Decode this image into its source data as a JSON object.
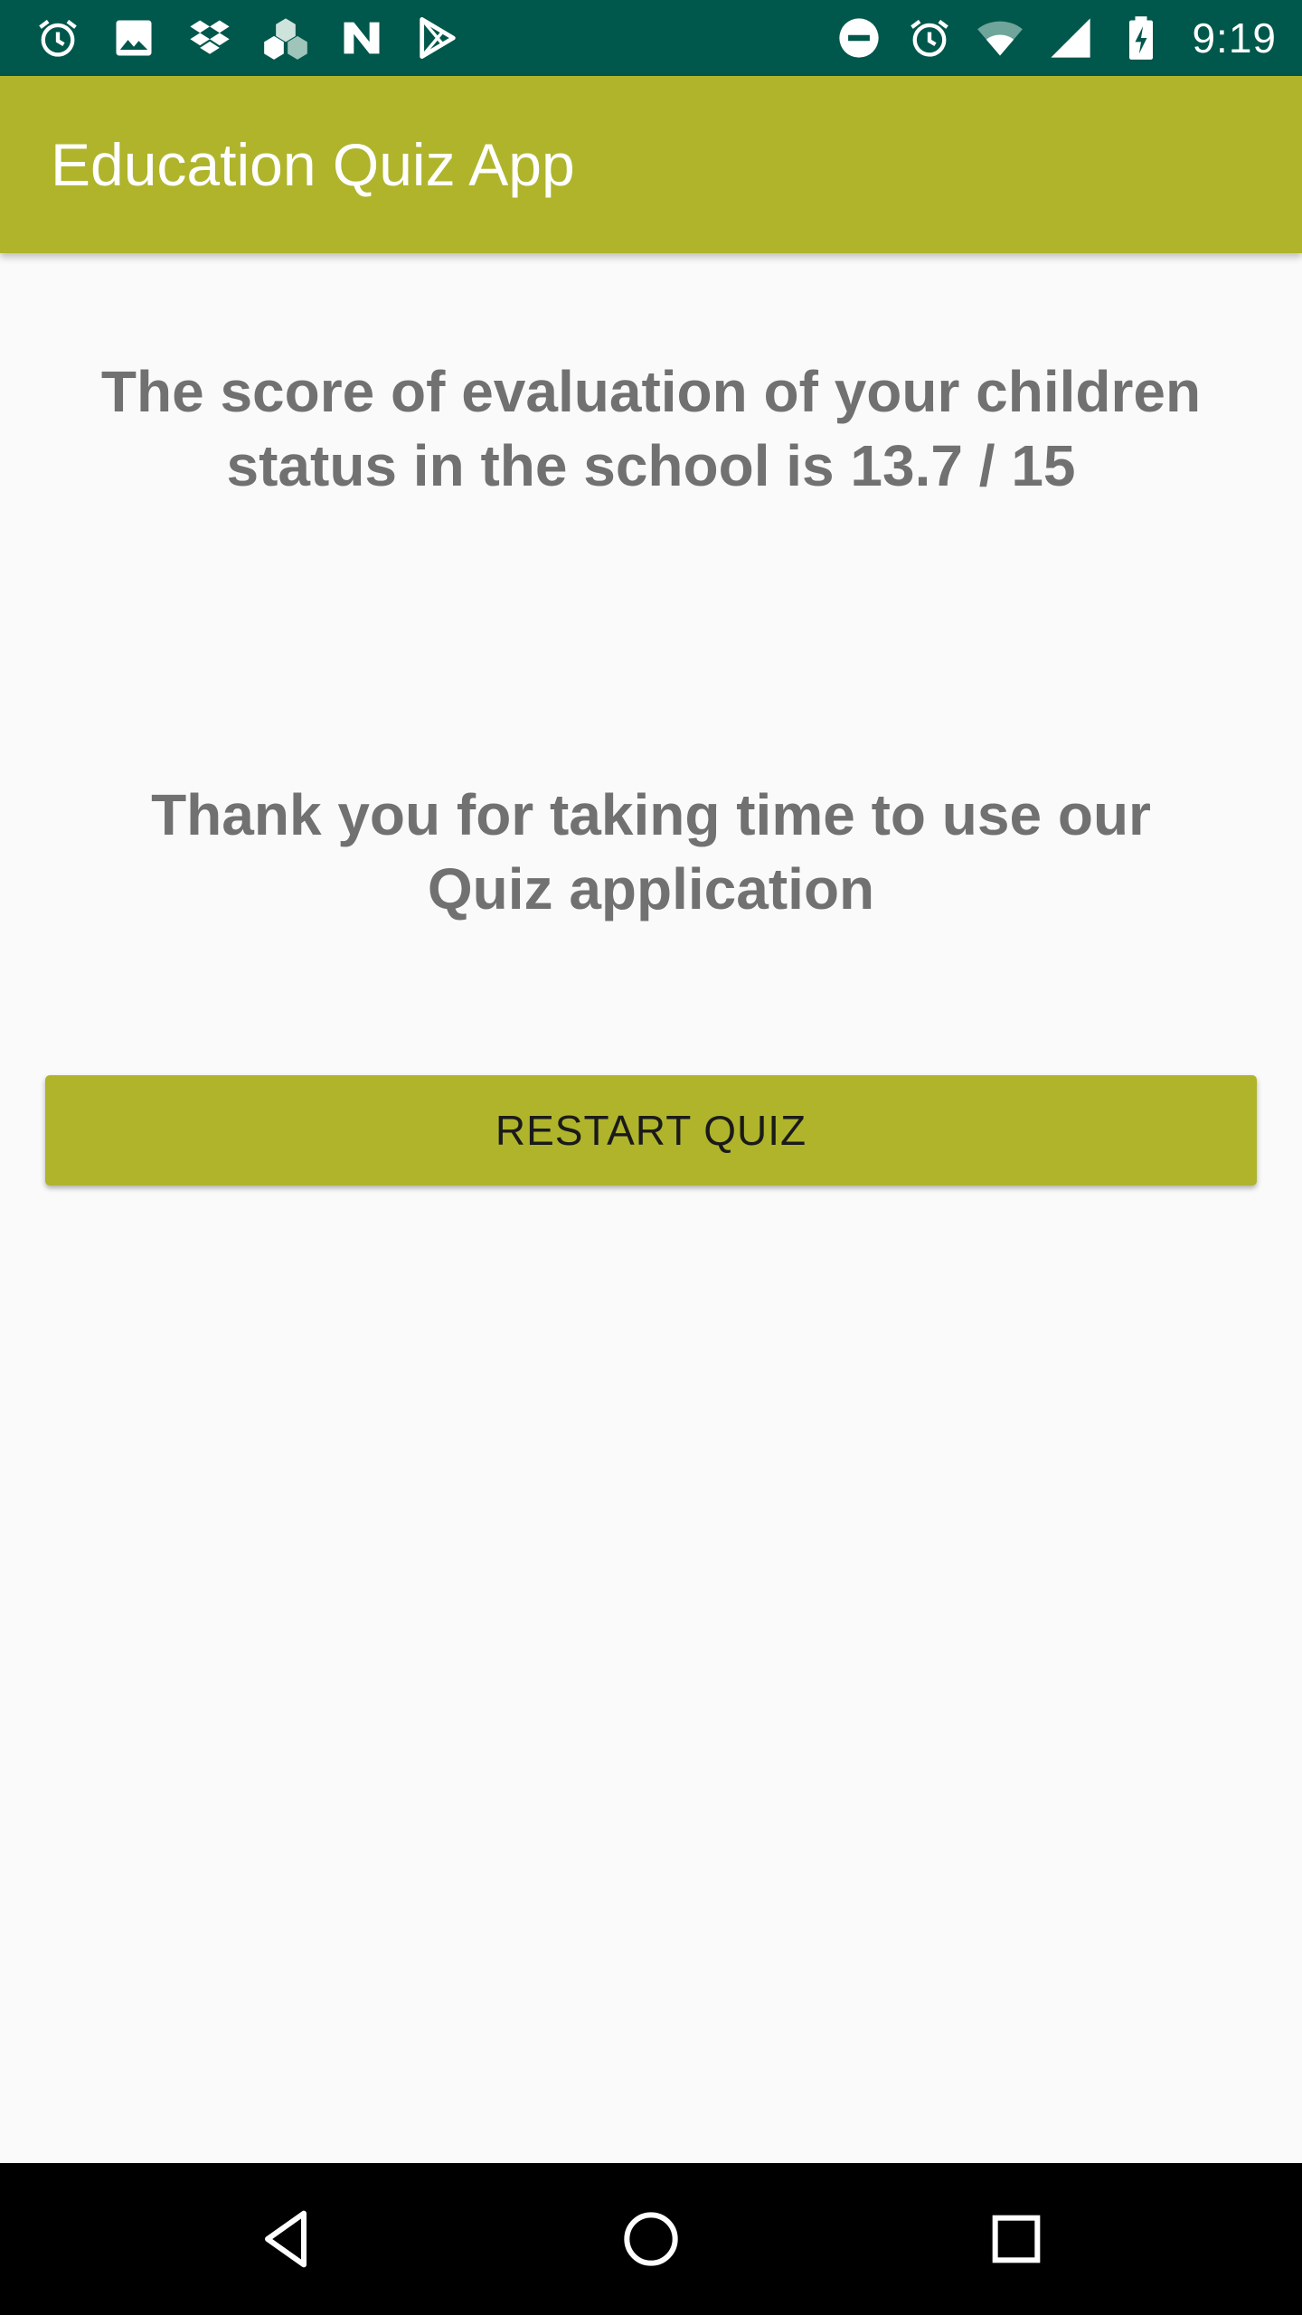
{
  "status_bar": {
    "time": "9:19",
    "left_icons": [
      "alarm-icon",
      "image-icon",
      "dropbox-icon",
      "cube-app-icon",
      "n-app-icon",
      "play-store-icon"
    ],
    "right_icons": [
      "do-not-disturb-icon",
      "alarm-icon",
      "wifi-icon",
      "cell-signal-icon",
      "battery-charging-icon"
    ]
  },
  "app_bar": {
    "title": "Education Quiz App"
  },
  "content": {
    "score_message": "The score of evaluation of your children status in the school is  13.7 / 15",
    "thanks_message": "Thank you for taking time to use our Quiz application",
    "restart_button_label": "RESTART QUIZ"
  },
  "nav_bar": {
    "buttons": [
      "back-icon",
      "home-icon",
      "recents-icon"
    ]
  },
  "colors": {
    "status_bar": "#00574b",
    "primary": "#afb42b",
    "text_gray": "#717171",
    "background": "#fafafa"
  }
}
